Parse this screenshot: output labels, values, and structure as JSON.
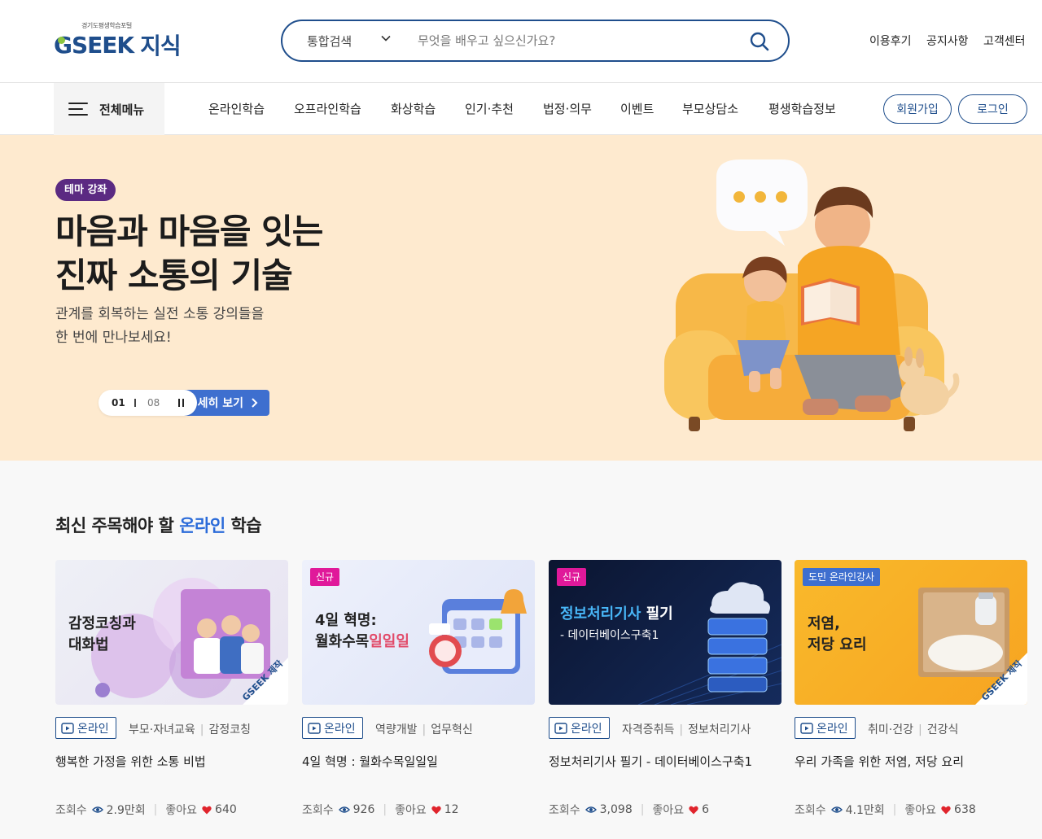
{
  "header": {
    "logo_sub": "경기도평생학습포털",
    "logo_g": "G",
    "logo_seek": "SEEK",
    "logo_jisik": "지식",
    "search_scope": "통합검색",
    "search_placeholder": "무엇을 배우고 싶으신가요?",
    "util": [
      "이용후기",
      "공지사항",
      "고객센터"
    ]
  },
  "gnb": {
    "allmenu": "전체메뉴",
    "items": [
      "온라인학습",
      "오프라인학습",
      "화상학습",
      "인기·추천",
      "법정·의무",
      "이벤트",
      "부모상담소",
      "평생학습정보"
    ],
    "signup": "회원가입",
    "login": "로그인"
  },
  "hero": {
    "badge": "테마 강좌",
    "title_line1": "마음과 마음을 잇는",
    "title_line2": "진짜 소통의 기술",
    "desc_line1": "관계를 회복하는 실전 소통 강의들을",
    "desc_line2": "한 번에 만나보세요!",
    "detail_button": "세히 보기",
    "pager_current": "01",
    "pager_total": "08"
  },
  "section": {
    "title_prefix": "최신 주목해야 할 ",
    "title_accent": "온라인",
    "title_suffix": " 학습"
  },
  "cards": [
    {
      "thumb_text_1": "감정코칭과",
      "thumb_text_2": "대화법",
      "thumb_stamp": "GSEEK 제작",
      "chip": "온라인",
      "cat1": "부모·자녀교육",
      "cat2": "감정코칭",
      "title": "행복한 가정을 위한 소통 비법",
      "views_label": "조회수",
      "views": "2.9만회",
      "likes_label": "좋아요",
      "likes": "640"
    },
    {
      "tag": "신규",
      "thumb_text_1": "4일 혁명:",
      "thumb_text_2a": "월화수목",
      "thumb_text_2b": "일일일",
      "chip": "온라인",
      "cat1": "역량개발",
      "cat2": "업무혁신",
      "title": "4일 혁명 : 월화수목일일일",
      "views_label": "조회수",
      "views": "926",
      "likes_label": "좋아요",
      "likes": "12"
    },
    {
      "tag": "신규",
      "thumb_text_1a": "정보처리기사",
      "thumb_text_1b": " 필기",
      "thumb_text_2": "- 데이터베이스구축1",
      "chip": "온라인",
      "cat1": "자격증취득",
      "cat2": "정보처리기사",
      "title": "정보처리기사 필기 - 데이터베이스구축1",
      "views_label": "조회수",
      "views": "3,098",
      "likes_label": "좋아요",
      "likes": "6"
    },
    {
      "tag": "도민 온라인강사",
      "thumb_text_1": "저염,",
      "thumb_text_2": "저당 요리",
      "thumb_stamp": "GSEEK 제작",
      "chip": "온라인",
      "cat1": "취미·건강",
      "cat2": "건강식",
      "title": "우리 가족을 위한 저염, 저당 요리",
      "views_label": "조회수",
      "views": "4.1만회",
      "likes_label": "좋아요",
      "likes": "638"
    }
  ],
  "colors": {
    "brand": "#1f4e8c",
    "accent": "#2b6bd9",
    "hero_bg": "#feeacf",
    "badge": "#5b2a82",
    "new_tag": "#e0199a",
    "heart": "#e0242c"
  }
}
